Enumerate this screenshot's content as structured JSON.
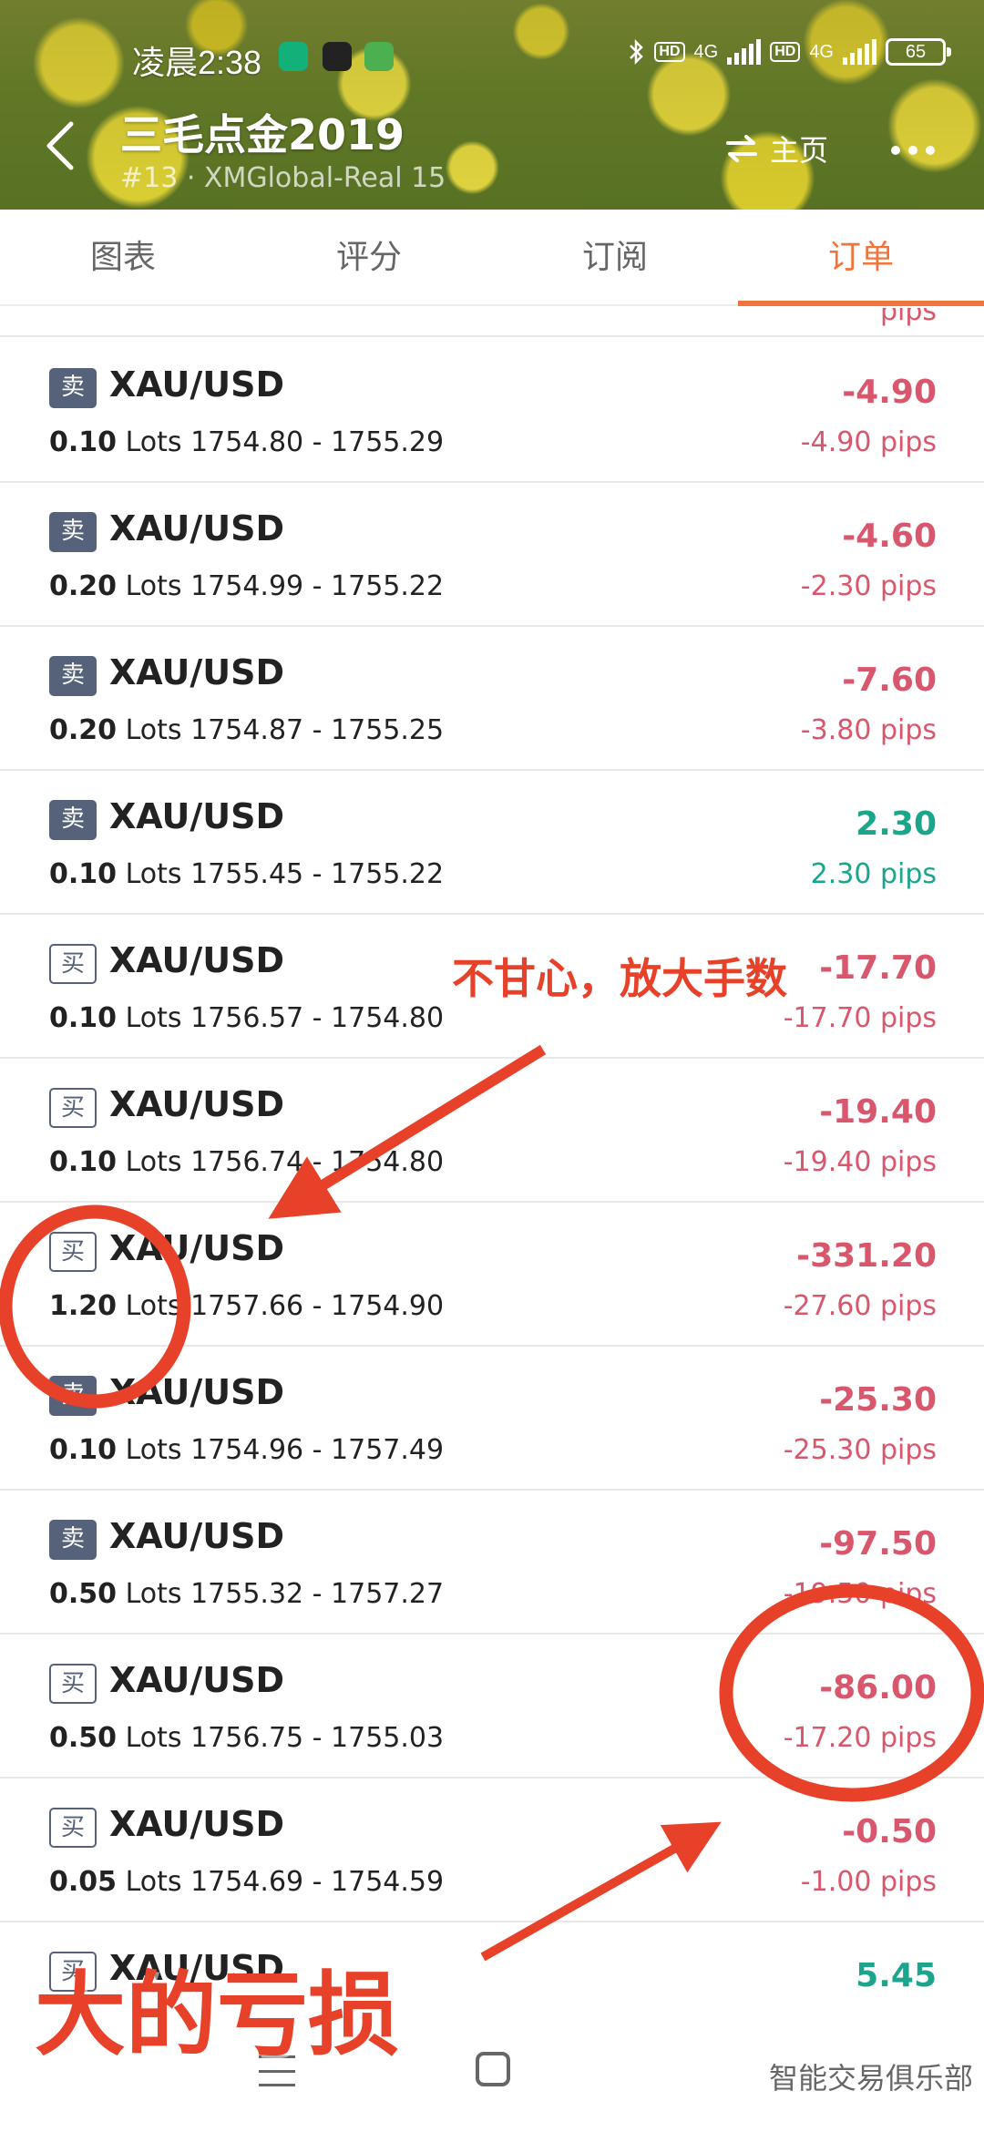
{
  "status_bar": {
    "time": "凌晨2:38",
    "hd1": "HD",
    "net1": "4G",
    "hd2": "HD",
    "net2": "4G",
    "battery": "65"
  },
  "header": {
    "title": "三毛点金2019",
    "subtitle": "#13 · XMGlobal-Real 15",
    "home_label": "主页"
  },
  "tabs": [
    "图表",
    "评分",
    "订阅",
    "订单"
  ],
  "orders": [
    {
      "side": "卖",
      "symbol": "XAU/USD",
      "lots": "0.10",
      "lots_unit": "Lots",
      "range": "1754.80 - 1755.29",
      "profit": "-4.90",
      "pips": "-4.90 pips"
    },
    {
      "side": "卖",
      "symbol": "XAU/USD",
      "lots": "0.20",
      "lots_unit": "Lots",
      "range": "1754.99 - 1755.22",
      "profit": "-4.60",
      "pips": "-2.30 pips"
    },
    {
      "side": "卖",
      "symbol": "XAU/USD",
      "lots": "0.20",
      "lots_unit": "Lots",
      "range": "1754.87 - 1755.25",
      "profit": "-7.60",
      "pips": "-3.80 pips"
    },
    {
      "side": "卖",
      "symbol": "XAU/USD",
      "lots": "0.10",
      "lots_unit": "Lots",
      "range": "1755.45 - 1755.22",
      "profit": "2.30",
      "pips": "2.30 pips"
    },
    {
      "side": "买",
      "symbol": "XAU/USD",
      "lots": "0.10",
      "lots_unit": "Lots",
      "range": "1756.57 - 1754.80",
      "profit": "-17.70",
      "pips": "-17.70 pips"
    },
    {
      "side": "买",
      "symbol": "XAU/USD",
      "lots": "0.10",
      "lots_unit": "Lots",
      "range": "1756.74 - 1754.80",
      "profit": "-19.40",
      "pips": "-19.40 pips"
    },
    {
      "side": "买",
      "symbol": "XAU/USD",
      "lots": "1.20",
      "lots_unit": "Lots",
      "range": "1757.66 - 1754.90",
      "profit": "-331.20",
      "pips": "-27.60 pips"
    },
    {
      "side": "卖",
      "symbol": "XAU/USD",
      "lots": "0.10",
      "lots_unit": "Lots",
      "range": "1754.96 - 1757.49",
      "profit": "-25.30",
      "pips": "-25.30 pips"
    },
    {
      "side": "卖",
      "symbol": "XAU/USD",
      "lots": "0.50",
      "lots_unit": "Lots",
      "range": "1755.32 - 1757.27",
      "profit": "-97.50",
      "pips": "-19.50 pips"
    },
    {
      "side": "买",
      "symbol": "XAU/USD",
      "lots": "0.50",
      "lots_unit": "Lots",
      "range": "1756.75 - 1755.03",
      "profit": "-86.00",
      "pips": "-17.20 pips"
    },
    {
      "side": "买",
      "symbol": "XAU/USD",
      "lots": "0.05",
      "lots_unit": "Lots",
      "range": "1754.69 - 1754.59",
      "profit": "-0.50",
      "pips": "-1.00 pips"
    },
    {
      "side": "买",
      "symbol": "XAU/USD",
      "lots": "",
      "lots_unit": "",
      "range": "",
      "profit": "5.45",
      "pips": ""
    }
  ],
  "partial_top_pips": "pips",
  "annotations": {
    "enlarge_lots": "不甘心，放大手数",
    "big_loss": "大的亏损"
  },
  "watermark": "智能交易俱乐部",
  "colors": {
    "accent": "#f0743c",
    "loss": "#d9576c",
    "gain": "#1aa58c",
    "sell_badge": "#55627a",
    "annotation": "#e8412a"
  },
  "icons": [
    "back-arrow-icon",
    "swap-icon",
    "more-icon",
    "shield-icon",
    "media-icon",
    "android-icon",
    "bluetooth-icon",
    "signal-icon",
    "battery-icon",
    "nav-menu-icon",
    "nav-home-icon"
  ]
}
